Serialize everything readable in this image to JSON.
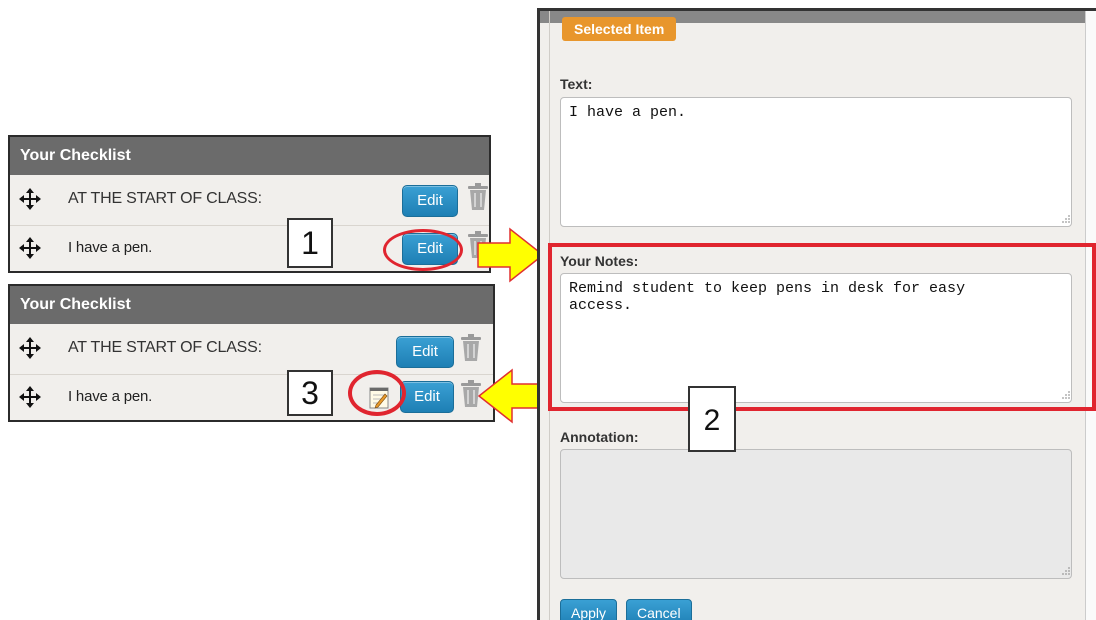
{
  "checklist_top": {
    "title": "Your Checklist",
    "rows": [
      {
        "label": "AT THE START OF CLASS:",
        "edit": "Edit"
      },
      {
        "label": "I have a pen.",
        "edit": "Edit"
      }
    ]
  },
  "checklist_bottom": {
    "title": "Your Checklist",
    "rows": [
      {
        "label": "AT THE START OF CLASS:",
        "edit": "Edit"
      },
      {
        "label": "I have a pen.",
        "edit": "Edit"
      }
    ]
  },
  "callouts": {
    "one": "1",
    "two": "2",
    "three": "3"
  },
  "selected_item": {
    "tag": "Selected Item",
    "text_label": "Text:",
    "text_value": "I have a pen.",
    "notes_label": "Your Notes:",
    "notes_value": "Remind student to keep pens in desk for easy\naccess.",
    "annotation_label": "Annotation:",
    "annotation_value": "",
    "apply": "Apply",
    "cancel": "Cancel"
  },
  "colors": {
    "header": "#6b6b6b",
    "edit_button": "#1e7fb4",
    "highlight": "#e0252f",
    "arrow_fill": "#ffff00",
    "tag": "#e8962c"
  },
  "icons": [
    "move-icon",
    "trash-icon",
    "notes-icon",
    "resize-grip-icon",
    "arrow-right-icon",
    "arrow-left-icon"
  ]
}
